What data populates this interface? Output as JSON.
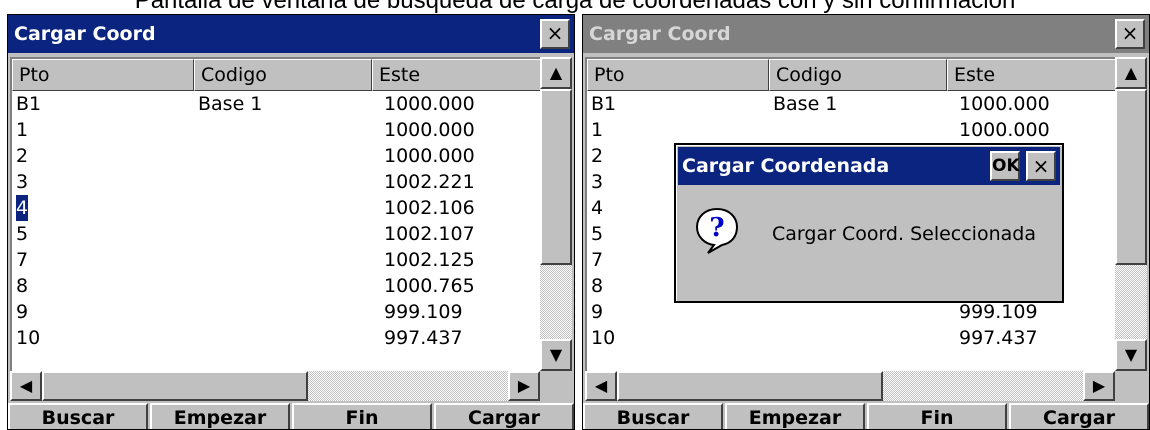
{
  "caption": "Pantalla de ventana de busqueda de carga de coordenadas con y sin confirmación",
  "windows": [
    {
      "title": "Cargar Coord",
      "close": "×",
      "columns": [
        "Pto",
        "Codigo",
        "Este"
      ],
      "rows": [
        {
          "pto": "B1",
          "codigo": "Base 1",
          "este": "1000.000"
        },
        {
          "pto": "1",
          "codigo": "",
          "este": "1000.000"
        },
        {
          "pto": "2",
          "codigo": "",
          "este": "1000.000"
        },
        {
          "pto": "3",
          "codigo": "",
          "este": "1002.221"
        },
        {
          "pto": "4",
          "codigo": "",
          "este": "1002.106"
        },
        {
          "pto": "5",
          "codigo": "",
          "este": "1002.107"
        },
        {
          "pto": "7",
          "codigo": "",
          "este": "1002.125"
        },
        {
          "pto": "8",
          "codigo": "",
          "este": "1000.765"
        },
        {
          "pto": "9",
          "codigo": "",
          "este": "999.109"
        },
        {
          "pto": "10",
          "codigo": "",
          "este": "997.437"
        }
      ],
      "selected_row": "4",
      "buttons": [
        "Buscar",
        "Empezar",
        "Fin",
        "Cargar"
      ]
    },
    {
      "title": "Cargar Coord",
      "close": "×",
      "columns": [
        "Pto",
        "Codigo",
        "Este"
      ],
      "rows": [
        {
          "pto": "B1",
          "codigo": "Base 1",
          "este": "1000.000"
        },
        {
          "pto": "1",
          "codigo": "",
          "este": "1000.000"
        },
        {
          "pto": "2",
          "codigo": "",
          "este": ""
        },
        {
          "pto": "3",
          "codigo": "",
          "este": ""
        },
        {
          "pto": "4",
          "codigo": "",
          "este": ""
        },
        {
          "pto": "5",
          "codigo": "",
          "este": ""
        },
        {
          "pto": "7",
          "codigo": "",
          "este": ""
        },
        {
          "pto": "8",
          "codigo": "",
          "este": ""
        },
        {
          "pto": "9",
          "codigo": "",
          "este": "999.109"
        },
        {
          "pto": "10",
          "codigo": "",
          "este": "997.437"
        }
      ],
      "buttons": [
        "Buscar",
        "Empezar",
        "Fin",
        "Cargar"
      ]
    }
  ],
  "dialog": {
    "title": "Cargar Coordenada",
    "ok": "OK",
    "close": "×",
    "message": "Cargar Coord. Seleccionada",
    "icon": "question-icon"
  },
  "scroll_glyphs": {
    "up": "▲",
    "down": "▼",
    "left": "◀",
    "right": "▶"
  },
  "colors": {
    "titlebar_active": "#0a2480",
    "titlebar_inactive": "#808080",
    "face": "#c0c0c0"
  }
}
